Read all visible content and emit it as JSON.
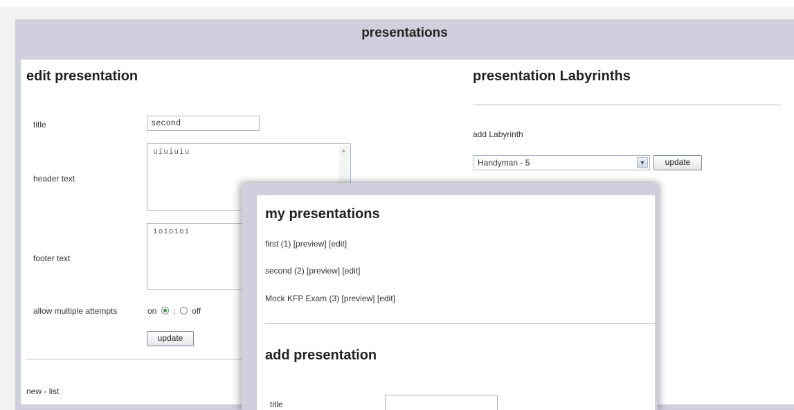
{
  "window": {
    "title": "presentations"
  },
  "edit_panel": {
    "heading": "edit presentation",
    "title_label": "title",
    "title_value": "second",
    "header_label": "header text",
    "header_value": "uiuiuiu",
    "footer_label": "footer text",
    "footer_value": "ioioioi",
    "attempts_label": "allow multiple attempts",
    "attempts_on": "on",
    "attempts_sep": ":",
    "attempts_off": "off",
    "attempts_selected": "on",
    "update_label": "update",
    "footer_links": {
      "new": "new",
      "sep": " - ",
      "list": "list"
    }
  },
  "labyrinths_panel": {
    "heading": "presentation Labyrinths",
    "add_label": "add Labyrinth",
    "select_value": "Handyman - 5",
    "update_label": "update"
  },
  "popup": {
    "heading": "my presentations",
    "presentations": [
      {
        "name": "first (1)",
        "preview": "[preview]",
        "edit": "[edit]"
      },
      {
        "name": "second (2)",
        "preview": "[preview]",
        "edit": "[edit]"
      },
      {
        "name": "Mock KFP Exam (3)",
        "preview": "[preview]",
        "edit": "[edit]"
      }
    ],
    "add_heading": "add presentation",
    "title_label": "title",
    "title_value": ""
  },
  "icons": {
    "select_arrow": "chevron-down-icon",
    "scroll_up": "chevron-up-icon"
  }
}
